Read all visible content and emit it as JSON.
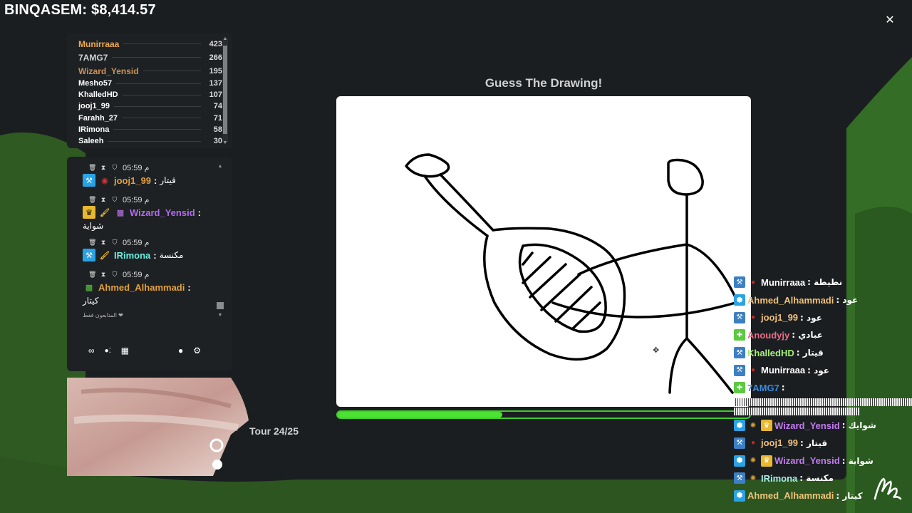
{
  "header": {
    "streamer_balance": "BINQASEM: $8,414.57"
  },
  "leaderboard": {
    "rows": [
      {
        "name": "Munirraaa",
        "score": "423",
        "color": "#f0a94a"
      },
      {
        "name": "7AMG7",
        "score": "266",
        "color": "#cfd1d3"
      },
      {
        "name": "Wizard_Yensid",
        "score": "195",
        "color": "#c89358"
      },
      {
        "name": "Mesho57",
        "score": "137",
        "color": "#ffffff"
      },
      {
        "name": "KhalledHD",
        "score": "107",
        "color": "#ffffff"
      },
      {
        "name": "jooj1_99",
        "score": "74",
        "color": "#ffffff"
      },
      {
        "name": "Farahh_27",
        "score": "71",
        "color": "#ffffff"
      },
      {
        "name": "IRimona",
        "score": "58",
        "color": "#ffffff"
      },
      {
        "name": "Saleeh",
        "score": "30",
        "color": "#ffffff"
      }
    ]
  },
  "chat": {
    "messages": [
      {
        "time": "05:59 م",
        "user": "jooj1_99",
        "suffix": ":",
        "text": "قيتار",
        "user_color": "#e3a03a",
        "cont": ""
      },
      {
        "time": "05:59 م",
        "user": "Wizard_Yensid",
        "suffix": ":",
        "text": "",
        "user_color": "#b36bf0",
        "cont": "شواية"
      },
      {
        "time": "05:59 م",
        "user": "IRimona",
        "suffix": ":",
        "text": "مكنسة",
        "user_color": "#6cf0df",
        "cont": ""
      },
      {
        "time": "05:59 م",
        "user": "Ahmed_Alhammadi",
        "suffix": ":",
        "text": "",
        "user_color": "#e3a03a",
        "cont": "كيتار"
      }
    ],
    "follower_note": "المتابعون فقط ❤",
    "tools": {
      "infinity": "∞",
      "store": "▦",
      "bubble": "●",
      "gear": "⚙"
    }
  },
  "game": {
    "title": "Guess The Drawing!",
    "round": "Tour 24/25",
    "progress": 0.4
  },
  "feed": [
    {
      "user": "Munirraaa",
      "text": ": نطيطة",
      "user_color": "#ffffff",
      "badges": [
        "#3d7fc4",
        "#c62828"
      ]
    },
    {
      "user": "Ahmed_Alhammadi",
      "text": ": عود",
      "user_color": "#f0c27a",
      "badges": [
        "#2aa2e6"
      ]
    },
    {
      "user": "jooj1_99",
      "text": ": عود",
      "user_color": "#f0c27a",
      "badges": [
        "#3d7fc4",
        "#c62828"
      ]
    },
    {
      "user": "Anoudyjy",
      "text": ": عبادي",
      "user_color": "#ea6d8a",
      "badges": [
        "#5cc940"
      ]
    },
    {
      "user": "KhalledHD",
      "text": ": قيتار",
      "user_color": "#a6f07a",
      "badges": [
        "#3d7fc4"
      ]
    },
    {
      "user": "Munirraaa",
      "text": ": عود",
      "user_color": "#ffffff",
      "badges": [
        "#3d7fc4",
        "#c62828"
      ]
    },
    {
      "user": "7AMG7",
      "text": ":",
      "user_color": "#3a8ae0",
      "badges": [
        "#5cc940"
      ]
    },
    {
      "glitch": true
    },
    {
      "user": "Wizard_Yensid",
      "text": ": شوايك",
      "user_color": "#c27af0",
      "badges": [
        "#2aa2e6",
        "#d4a03a",
        "#e8b830"
      ]
    },
    {
      "user": "jooj1_99",
      "text": ": قيتار",
      "user_color": "#f0c27a",
      "badges": [
        "#3d7fc4",
        "#c62828"
      ]
    },
    {
      "user": "Wizard_Yensid",
      "text": ": شواية",
      "user_color": "#c27af0",
      "badges": [
        "#2aa2e6",
        "#d4a03a",
        "#e8b830"
      ]
    },
    {
      "user": "IRimona",
      "text": ": مكنسة",
      "user_color": "#a6f0e6",
      "badges": [
        "#3d7fc4",
        "#d4a03a"
      ]
    },
    {
      "user": "Ahmed_Alhammadi",
      "text": ": كيتار",
      "user_color": "#f0c27a",
      "badges": [
        "#2aa2e6"
      ]
    }
  ]
}
